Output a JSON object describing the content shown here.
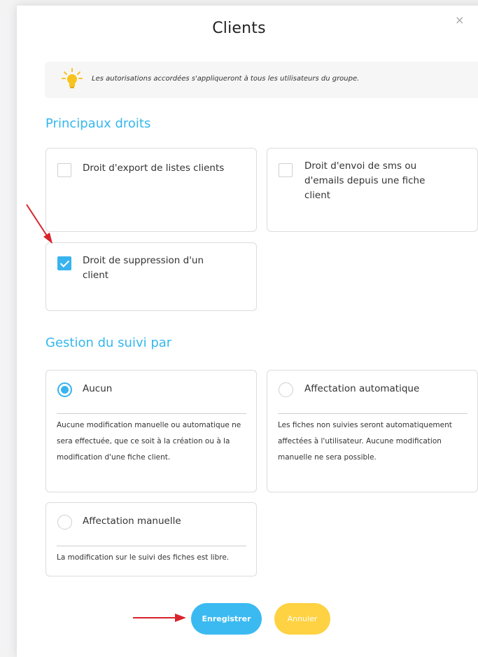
{
  "dialog": {
    "title": "Clients",
    "close_symbol": "×",
    "info_text": "Les autorisations accordées s'appliqueront à tous les utilisateurs du groupe."
  },
  "rights": {
    "heading": "Principaux droits",
    "items": [
      {
        "label": "Droit d'export de listes clients",
        "checked": false
      },
      {
        "label": "Droit d'envoi de sms ou d'emails depuis une fiche client",
        "checked": false
      },
      {
        "label": "Droit de suppression d'un client",
        "checked": true
      }
    ]
  },
  "tracking": {
    "heading": "Gestion du suivi par",
    "options": [
      {
        "label": "Aucun",
        "selected": true,
        "description": "Aucune modification manuelle ou automatique ne sera effectuée, que ce soit à la création ou à la modification d'une fiche client."
      },
      {
        "label": "Affectation automatique",
        "selected": false,
        "description": "Les fiches non suivies seront automatiquement affectées à l'utilisateur. Aucune modification manuelle ne sera possible."
      },
      {
        "label": "Affectation manuelle",
        "selected": false,
        "description": "La modification sur le suivi des fiches est libre."
      }
    ]
  },
  "actions": {
    "save_label": "Enregistrer",
    "cancel_label": "Annuler"
  },
  "colors": {
    "accent": "#39b3ef",
    "save_button": "#3bbaf1",
    "cancel_button": "#fed242",
    "annotation_arrow": "#d9232b"
  }
}
